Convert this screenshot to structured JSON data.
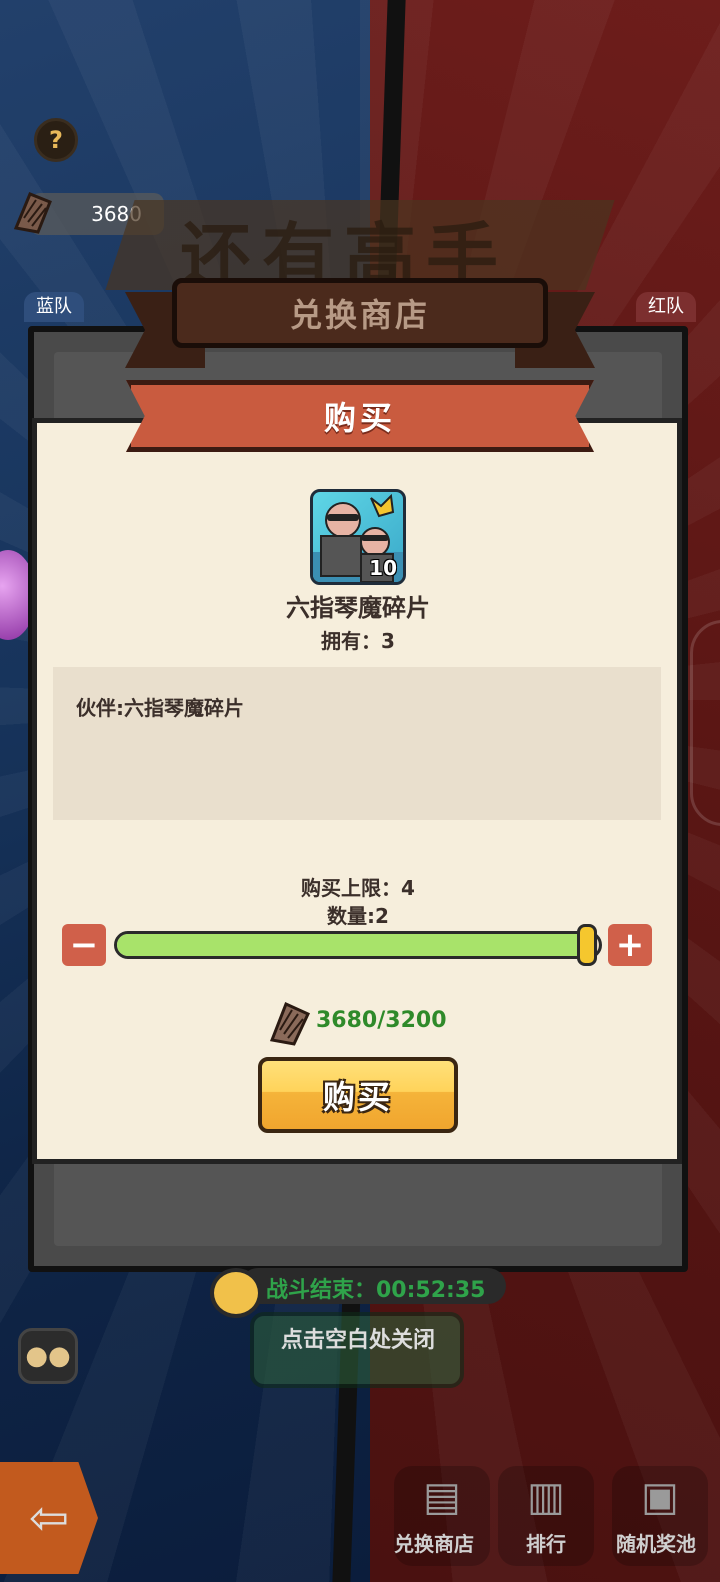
{
  "background": {
    "help_label": "?",
    "currency_value": "3680",
    "banner_title": "还有高手",
    "left_team": "蓝队",
    "right_team": "红队"
  },
  "shop": {
    "title": "兑换商店"
  },
  "purchase": {
    "title": "购买",
    "item_count_badge": "10",
    "item_name": "六指琴魔碎片",
    "owned_label": "拥有：3",
    "description": "伙伴:六指琴魔碎片",
    "limit_label": "购买上限：4",
    "quantity_label": "数量:2",
    "minus": "−",
    "plus": "+",
    "slider_fraction": 0.97,
    "cost_text": "3680/3200",
    "buy_button": "购买"
  },
  "battle": {
    "timer": "战斗结束：00:52:35",
    "close_hint": "点击空白处关闭"
  },
  "bottom_tabs": [
    {
      "label": "兑换商店"
    },
    {
      "label": "排行"
    },
    {
      "label": "随机奖池"
    }
  ],
  "colors": {
    "accent": "#c95b3f",
    "cost_green": "#2f8a2a",
    "slider_green": "#a8e36a"
  }
}
